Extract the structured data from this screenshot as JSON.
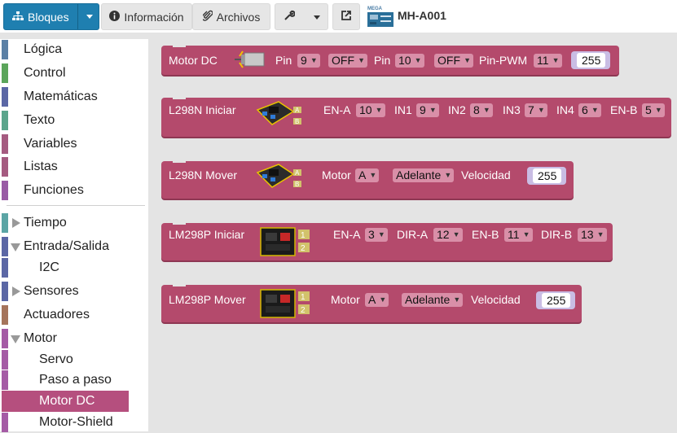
{
  "toolbar": {
    "blocks_label": "Bloques",
    "info_label": "Información",
    "files_label": "Archivos",
    "board_badge": "MEGA",
    "board_name": "MH-A001"
  },
  "sidebar": {
    "items": [
      {
        "label": "Lógica",
        "color": "#5b80a5"
      },
      {
        "label": "Control",
        "color": "#5ba55b"
      },
      {
        "label": "Matemáticas",
        "color": "#5b67a5"
      },
      {
        "label": "Texto",
        "color": "#5ba58c"
      },
      {
        "label": "Variables",
        "color": "#a55b80"
      },
      {
        "label": "Listas",
        "color": "#a55b80"
      },
      {
        "label": "Funciones",
        "color": "#995ba5"
      },
      {
        "label": "Tiempo",
        "color": "#5ba5a5"
      },
      {
        "label": "Entrada/Salida",
        "color": "#5b67a5"
      },
      {
        "label": "I2C",
        "color": "#5b67a5"
      },
      {
        "label": "Sensores",
        "color": "#5b67a5"
      },
      {
        "label": "Actuadores",
        "color": "#a5745b"
      },
      {
        "label": "Motor",
        "color": "#a55ba5"
      },
      {
        "label": "Servo",
        "color": "#a55ba5"
      },
      {
        "label": "Paso a paso",
        "color": "#a55ba5"
      },
      {
        "label": "Motor DC",
        "color": "#b54f7e"
      },
      {
        "label": "Motor-Shield",
        "color": "#a55ba5"
      }
    ]
  },
  "blocks": {
    "b1": {
      "title": "Motor DC",
      "pin_label": "Pin",
      "pin1": "9",
      "state1": "OFF",
      "pin_label2": "Pin",
      "pin2": "10",
      "state2": "OFF",
      "pwm_label": "Pin-PWM",
      "pwm": "11",
      "value": "255"
    },
    "b2": {
      "title": "L298N Iniciar",
      "ena_label": "EN-A",
      "ena": "10",
      "in1_label": "IN1",
      "in1": "9",
      "in2_label": "IN2",
      "in2": "8",
      "in3_label": "IN3",
      "in3": "7",
      "in4_label": "IN4",
      "in4": "6",
      "enb_label": "EN-B",
      "enb": "5"
    },
    "b3": {
      "title": "L298N Mover",
      "motor_label": "Motor",
      "motor": "A",
      "direction": "Adelante",
      "speed_label": "Velocidad",
      "speed": "255"
    },
    "b4": {
      "title": "LM298P Iniciar",
      "ena_label": "EN-A",
      "ena": "3",
      "dira_label": "DIR-A",
      "dira": "12",
      "enb_label": "EN-B",
      "enb": "11",
      "dirb_label": "DIR-B",
      "dirb": "13"
    },
    "b5": {
      "title": "LM298P Mover",
      "motor_label": "Motor",
      "motor": "A",
      "direction": "Adelante",
      "speed_label": "Velocidad",
      "speed": "255"
    }
  }
}
